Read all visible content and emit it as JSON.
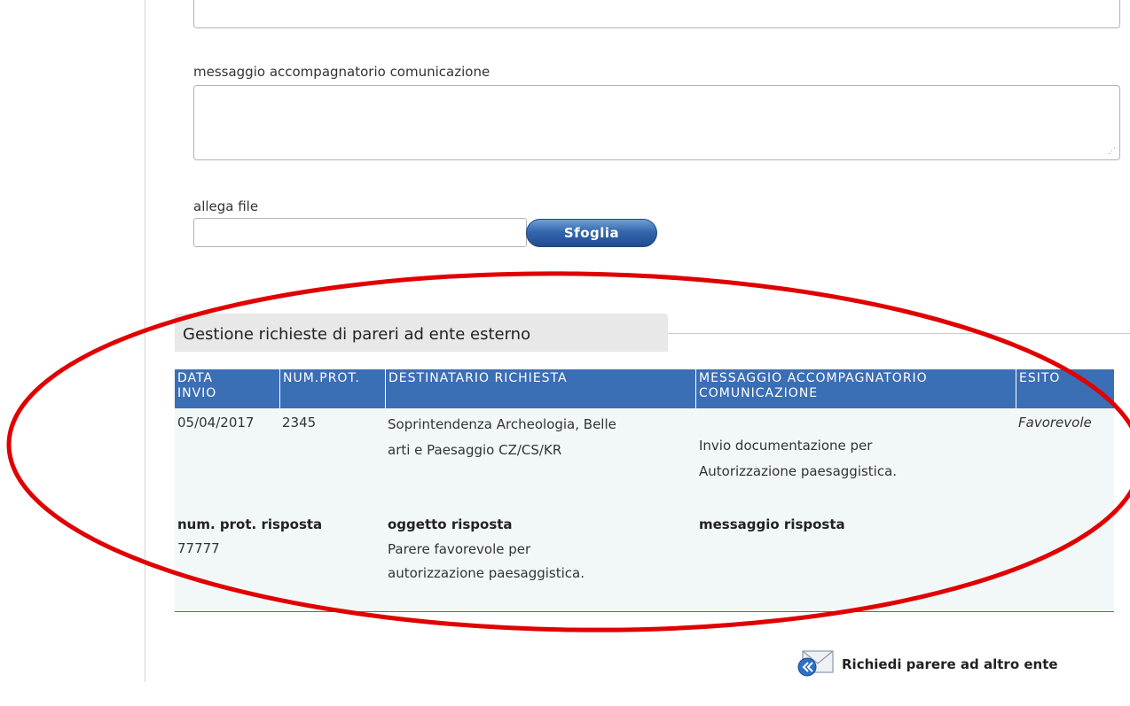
{
  "form": {
    "message_label": "messaggio accompagnatorio comunicazione",
    "message_value": "",
    "attach_label": "allega file",
    "attach_value": "",
    "browse_label": "Sfoglia"
  },
  "section": {
    "title": "Gestione richieste di pareri ad ente esterno"
  },
  "table": {
    "headers": {
      "data_invio": [
        "DATA",
        "INVIO"
      ],
      "num_prot": "NUM.PROT.",
      "destinatario": "DESTINATARIO RICHIESTA",
      "messaggio": [
        "MESSAGGIO ACCOMPAGNATORIO",
        "COMUNICAZIONE"
      ],
      "esito": "ESITO"
    },
    "row": {
      "data_invio": "05/04/2017",
      "num_prot": "2345",
      "destinatario": [
        "Soprintendenza Archeologia, Belle",
        "arti e Paesaggio CZ/CS/KR"
      ],
      "messaggio": [
        "Invio documentazione per",
        "Autorizzazione paesaggistica."
      ],
      "esito": "Favorevole"
    },
    "response": {
      "num_prot_label": "num. prot. risposta",
      "num_prot_value": "77777",
      "oggetto_label": "oggetto risposta",
      "oggetto_value": [
        "Parere favorevole per",
        "autorizzazione paesaggistica."
      ],
      "messaggio_label": "messaggio risposta",
      "messaggio_value": ""
    }
  },
  "actions": {
    "request_other_label": "Richiedi parere ad altro ente",
    "request_other_icon": "envelope-back-icon"
  },
  "colors": {
    "header_blue": "#3a6eb5",
    "annotation_red": "#e00000",
    "row_bg": "#f2f8f8"
  }
}
